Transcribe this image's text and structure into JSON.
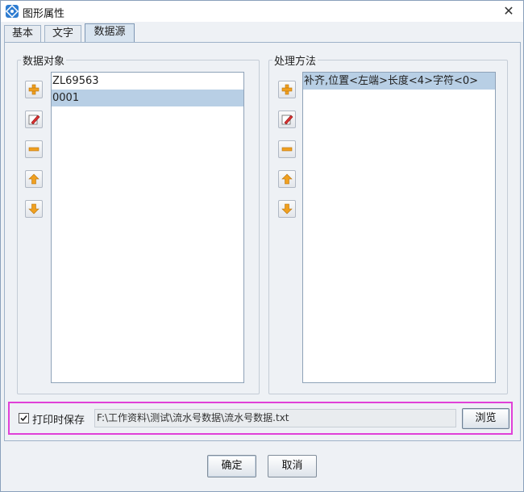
{
  "window": {
    "title": "图形属性",
    "close_glyph": "✕"
  },
  "tabs": [
    {
      "label": "基本",
      "active": false
    },
    {
      "label": "文字",
      "active": false
    },
    {
      "label": "数据源",
      "active": true
    }
  ],
  "data_objects": {
    "title": "数据对象",
    "items": [
      "ZL69563",
      "0001"
    ],
    "selected_index": 1
  },
  "processing": {
    "title": "处理方法",
    "items": [
      "补齐,位置<左端>长度<4>字符<0>"
    ],
    "selected_index": 0
  },
  "side_buttons": [
    "add-icon",
    "edit-icon",
    "remove-icon",
    "move-up-icon",
    "move-down-icon"
  ],
  "save": {
    "label": "打印时保存",
    "checked": true,
    "path": "F:\\工作资料\\测试\\流水号数据\\流水号数据.txt",
    "browse_label": "浏览"
  },
  "footer": {
    "ok_label": "确定",
    "cancel_label": "取消"
  },
  "colors": {
    "selection": "#b8cfe5",
    "highlight_border": "#e040d8",
    "icon_orange": "#f0a020"
  }
}
